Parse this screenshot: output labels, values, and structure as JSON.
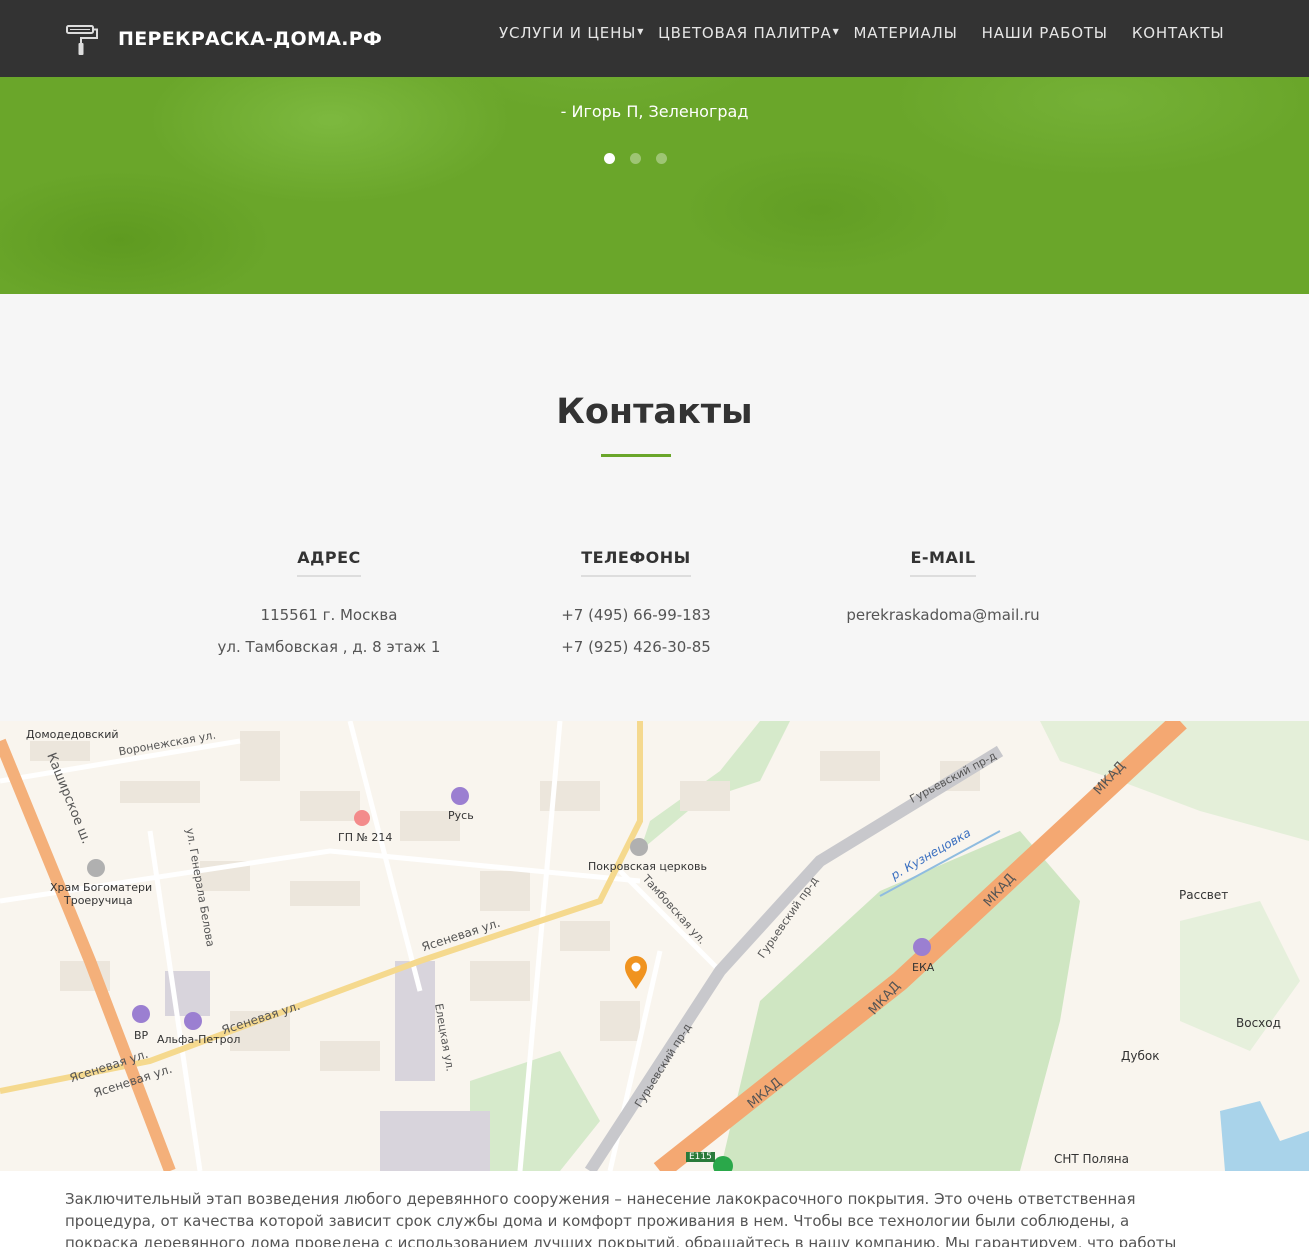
{
  "header": {
    "brand": "ПЕРЕКРАСКА-ДОМА.РФ",
    "nav": [
      {
        "label": "УСЛУГИ И ЦЕНЫ",
        "dropdown": true
      },
      {
        "label": "ЦВЕТОВАЯ ПАЛИТРА",
        "dropdown": true
      },
      {
        "label": "МАТЕРИАЛЫ",
        "dropdown": false
      },
      {
        "label": "НАШИ РАБОТЫ",
        "dropdown": false
      },
      {
        "label": "КОНТАКТЫ",
        "dropdown": false
      }
    ]
  },
  "hero": {
    "author": "- Игорь П, Зеленоград",
    "slides_total": 3,
    "active_slide": 1
  },
  "contacts": {
    "title": "Контакты",
    "address": {
      "heading": "АДРЕС",
      "lines": [
        "115561 г. Москва",
        "ул. Тамбовская , д. 8 этаж 1"
      ]
    },
    "phones": {
      "heading": "ТЕЛЕФОНЫ",
      "lines": [
        "+7 (495) 66-99-183",
        "+7 (925) 426-30-85"
      ]
    },
    "email": {
      "heading": "E-MAIL",
      "lines": [
        "perekraskadoma@mail.ru"
      ]
    }
  },
  "map": {
    "labels": {
      "domodedovsky": "Домодедовский",
      "voronezhskaya": "Воронежская ул.",
      "kashirskoe": "Каширское ш.",
      "hram": "Храм Богоматери",
      "troeruchitsa": "Троеручица",
      "generala_belova": "ул. Генерала Белова",
      "gp214": "ГП № 214",
      "rus": "Русь",
      "pokrovskaya": "Покровская церковь",
      "tambovskaya": "Тамбовская ул.",
      "yasenevaya1": "Ясеневая ул.",
      "yasenevaya2": "Ясеневая ул.",
      "yasenevaya3": "Ясеневая ул.",
      "yasenevaya4": "Ясеневая ул.",
      "bp": "BP",
      "alfa": "Альфа-Петрол",
      "eletskaya": "Елецкая ул.",
      "guryevsky1": "Гурьевский пр-д",
      "guryevsky2": "Гурьевский пр-д",
      "guryevsky3": "Гурьевский пр-д",
      "kuznetsovka": "р. Кузнецовка",
      "mkad1": "МКАД",
      "mkad2": "МКАД",
      "mkad3": "МКАД",
      "mkad4": "МКАД",
      "eka": "ЕКА",
      "rassvet": "Рассвет",
      "voskhod": "Восход",
      "dubok": "Дубок",
      "snt": "СНТ Поляна",
      "e115": "E115"
    }
  },
  "about": {
    "text": "Заключительный этап возведения любого деревянного сооружения – нанесение лакокрасочного покрытия. Это очень ответственная процедура, от качества которой зависит срок службы дома и комфорт проживания в нем. Чтобы все технологии были соблюдены, а покраска деревянного дома проведена с использованием лучших покрытий, обращайтесь в нашу компанию. Мы гарантируем, что работы будут выполнены опытными"
  }
}
